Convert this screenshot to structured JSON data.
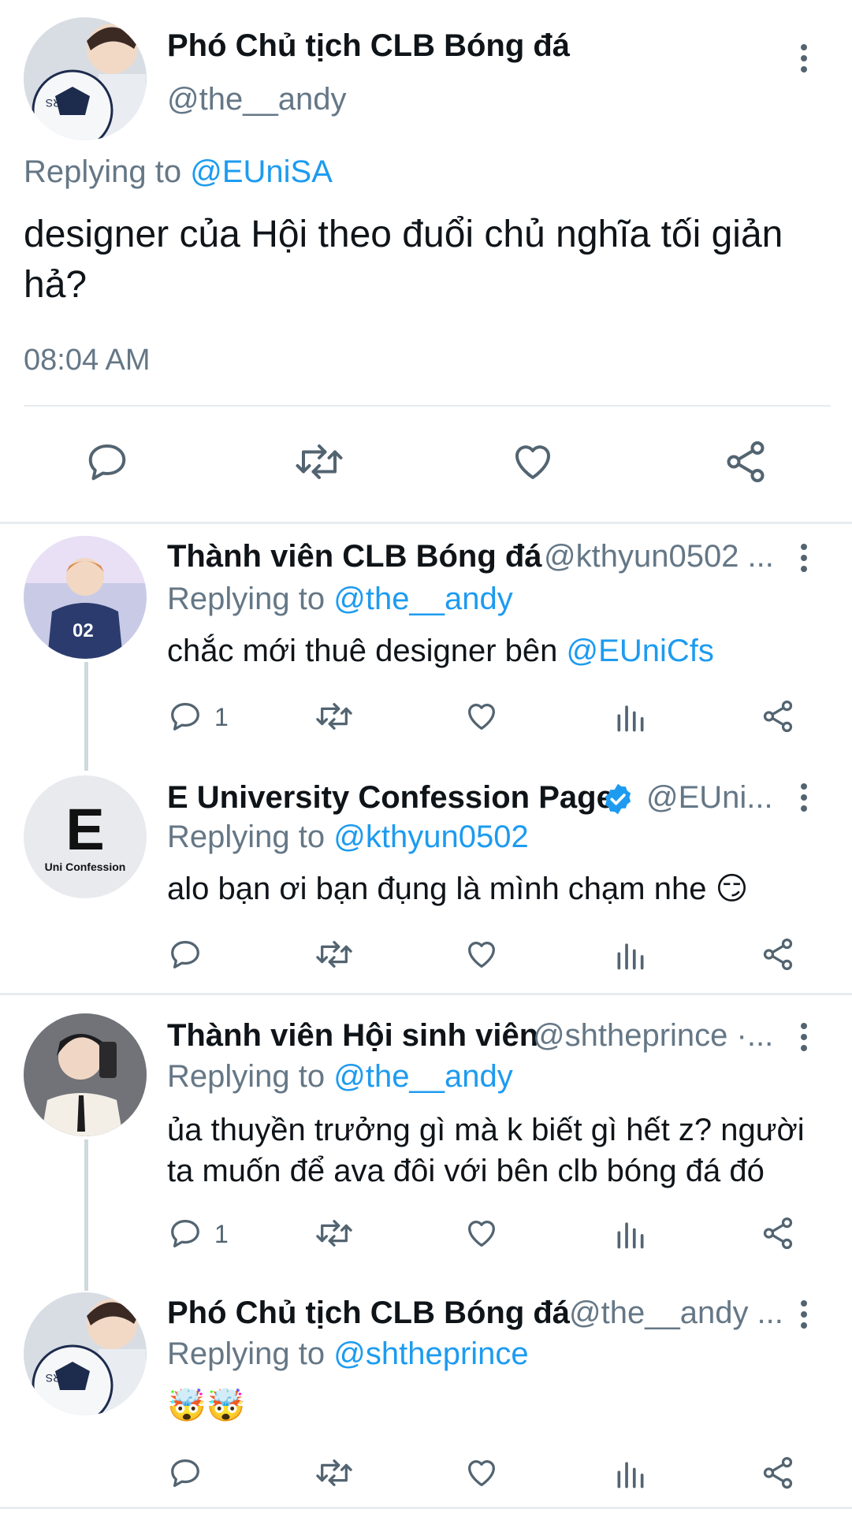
{
  "main_tweet": {
    "name": "Phó Chủ tịch CLB Bóng đá",
    "handle": "@the__andy",
    "replying_prefix": "Replying to",
    "replying_to": "@EUniSA",
    "text": "designer của Hội theo đuổi chủ nghĩa tối giản hả?",
    "time": "08:04 AM"
  },
  "replies": [
    {
      "name": "Thành viên CLB Bóng đá",
      "handle": "@kthyun0502 ...",
      "replying_prefix": "Replying to",
      "replying_to": "@the__andy",
      "text": "chắc mới thuê designer bên",
      "mention": "@EUniCfs",
      "reply_count": "1"
    },
    {
      "name": "E University Confession Page",
      "handle": "@EUni...",
      "verified": true,
      "replying_prefix": "Replying to",
      "replying_to": "@kthyun0502",
      "text": "alo bạn ơi bạn đụng là mình chạm nhe 😏",
      "avatar_letter": "E",
      "avatar_caption": "Uni Confession"
    },
    {
      "name": "Thành viên Hội sinh viên",
      "handle": "@shtheprince ·...",
      "replying_prefix": "Replying to",
      "replying_to": "@the__andy",
      "text": "ủa thuyền trưởng gì mà k biết gì hết z? người ta muốn để ava đôi với bên clb bóng đá đó",
      "reply_count": "1"
    },
    {
      "name": "Phó Chủ tịch CLB Bóng đá",
      "handle": "@the__andy ...",
      "replying_prefix": "Replying to",
      "replying_to": "@shtheprince",
      "text": "🤯🤯"
    }
  ],
  "colors": {
    "accent": "#1d9bf0",
    "muted": "#657786",
    "icon": "#536471",
    "divider": "#e6ecf0"
  }
}
